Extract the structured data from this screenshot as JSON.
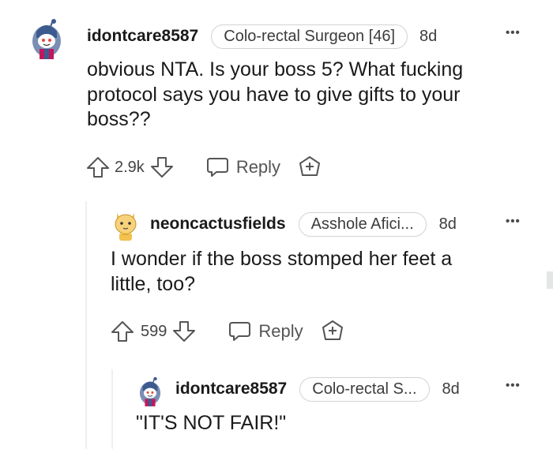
{
  "comments": [
    {
      "username": "idontcare8587",
      "flair": "Colo-rectal Surgeon [46]",
      "age": "8d",
      "more": "•••",
      "body_lines": [
        "obvious NTA. Is your boss 5? What fucking",
        "protocol says you have to give gifts to your",
        "boss??"
      ],
      "votes": "2.9k",
      "reply_label": "Reply",
      "avatar_icon": "snoo-avatar-icon"
    },
    {
      "username": "neoncactusfields",
      "flair": "Asshole Afici...",
      "age": "8d",
      "more": "•••",
      "body_lines": [
        "I wonder if the boss stomped her feet a",
        "little, too?"
      ],
      "votes": "599",
      "reply_label": "Reply",
      "avatar_icon": "cat-avatar-icon"
    },
    {
      "username": "idontcare8587",
      "flair": "Colo-rectal S...",
      "age": "8d",
      "more": "•••",
      "body_lines": [
        "\"IT'S NOT FAIR!\""
      ],
      "avatar_icon": "snoo-avatar-icon"
    }
  ],
  "colors": {
    "text": "#1a1a1b",
    "muted": "#555555",
    "flair_border": "#d0d3d6",
    "thread_line": "#edeff1"
  },
  "icons": [
    "upvote-icon",
    "downvote-icon",
    "reply-bubble-icon",
    "award-plus-icon",
    "more-options-icon"
  ]
}
